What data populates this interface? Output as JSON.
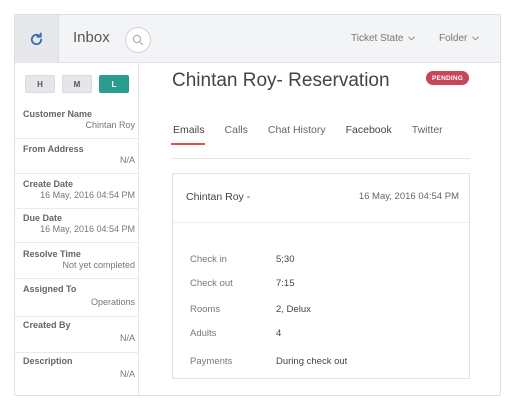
{
  "header": {
    "refresh_icon": "refresh-icon",
    "title": "Inbox",
    "search_icon": "search-icon",
    "ticket_state_label": "Ticket State",
    "folder_label": "Folder"
  },
  "sidebar": {
    "priority": [
      {
        "label": "H",
        "active": false
      },
      {
        "label": "M",
        "active": false
      },
      {
        "label": "L",
        "active": true
      }
    ],
    "fields": [
      {
        "label": "Customer Name",
        "value": "Chintan Roy"
      },
      {
        "label": "From Address",
        "value": "N/A"
      },
      {
        "label": "Create Date",
        "value": "16 May, 2016 04:54 PM"
      },
      {
        "label": "Due Date",
        "value": "16 May, 2016 04:54 PM"
      },
      {
        "label": "Resolve Time",
        "value": "Not yet completed"
      },
      {
        "label": "Assigned To",
        "value": "Operations"
      },
      {
        "label": "Created By",
        "value": "N/A"
      },
      {
        "label": "Description",
        "value": "N/A"
      }
    ]
  },
  "ticket": {
    "title": "Chintan Roy- Reservation",
    "status_badge": "PENDING",
    "tabs": [
      "Emails",
      "Calls",
      "Chat History",
      "Facebook",
      "Twitter"
    ],
    "active_tab": "Emails"
  },
  "email": {
    "from": "Chintan Roy -",
    "date": "16 May, 2016 04:54 PM",
    "details": [
      {
        "key": "Check in",
        "value": "5;30"
      },
      {
        "key": "Check out",
        "value": "7:15"
      },
      {
        "key": "Rooms",
        "value": "2, Delux"
      },
      {
        "key": "Adults",
        "value": "4"
      },
      {
        "key": "Payments",
        "value": "During check out"
      }
    ]
  },
  "colors": {
    "accent_teal": "#2a9d8f",
    "pending_badge": "#c9455a",
    "active_tab_underline": "#d9534f"
  }
}
